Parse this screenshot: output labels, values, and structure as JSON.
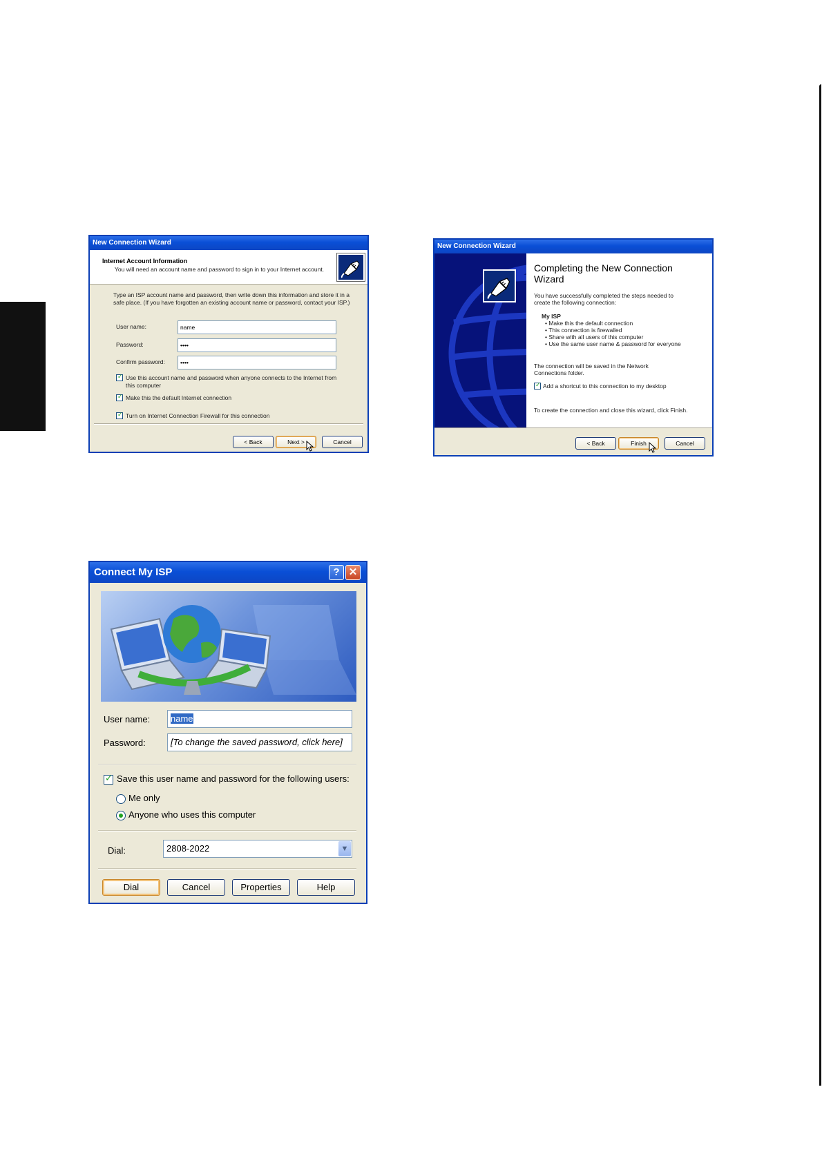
{
  "wizard1": {
    "title": "New Connection Wizard",
    "header_title": "Internet Account Information",
    "header_subtitle": "You will need an account name and password to sign in to your Internet account.",
    "intro_line1": "Type an ISP account name and password, then write down this information and store it in a",
    "intro_line2": "safe place. (If you have forgotten an existing account name or password, contact your ISP.)",
    "username_label": "User name:",
    "username_value": "name",
    "password_label": "Password:",
    "password_value": "••••",
    "confirm_label": "Confirm password:",
    "confirm_value": "••••",
    "check_use_account_line1": "Use this account  name and password when anyone connects to the Internet from",
    "check_use_account_line2": "this computer",
    "check_default": "Make this the default Internet connection",
    "check_firewall": "Turn on Internet Connection Firewall for this connection",
    "back_button": "< Back",
    "next_button": "Next >",
    "cancel_button": "Cancel"
  },
  "wizard2": {
    "title": "New Connection Wizard",
    "heading": "Completing the New Connection Wizard",
    "success_line1": "You have successfully completed the steps needed to",
    "success_line2": "create the following connection:",
    "connection_name": "My ISP",
    "bullets": [
      "Make this the default connection",
      "This connection is firewalled",
      "Share with all users of this computer",
      "Use the same user name & password for everyone"
    ],
    "saved_line1": "The connection will be saved in the Network",
    "saved_line2": "Connections folder.",
    "shortcut_check": "Add a shortcut to this connection to my desktop",
    "finish_instruction": "To create the connection and close this wizard, click Finish.",
    "back_button": "< Back",
    "finish_button": "Finish",
    "cancel_button": "Cancel"
  },
  "connect_dialog": {
    "title": "Connect My ISP",
    "help_glyph": "?",
    "close_glyph": "✕",
    "username_label": "User name:",
    "username_value": "name",
    "password_label": "Password:",
    "password_value": "[To change the saved password, click here]",
    "save_check": "Save this user name and password for the following users:",
    "radio_me": "Me only",
    "radio_anyone": "Anyone who uses this computer",
    "dial_label": "Dial:",
    "dial_value": "2808-2022",
    "dial_button": "Dial",
    "cancel_button": "Cancel",
    "properties_button": "Properties",
    "help_button": "Help"
  }
}
